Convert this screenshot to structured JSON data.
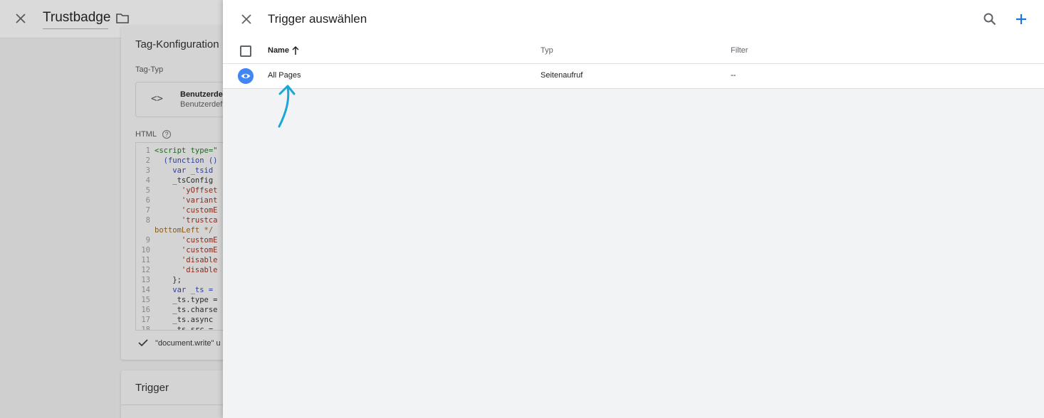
{
  "background_editor": {
    "title": "Trustbadge",
    "section_title": "Tag-Konfiguration",
    "tag_type_label": "Tag-Typ",
    "tag_type_name": "Benutzerde",
    "tag_type_sub": "Benutzerdef",
    "code_icon": "<>",
    "html_label": "HTML",
    "help_glyph": "?",
    "code_lines": [
      {
        "num": "1",
        "text": "<script type=\"",
        "style": "tag"
      },
      {
        "num": "2",
        "text": "  (function ()",
        "style": "kw"
      },
      {
        "num": "3",
        "text": "    var _tsid",
        "style": "kw"
      },
      {
        "num": "4",
        "text": "    _tsConfig",
        "style": "plain"
      },
      {
        "num": "5",
        "text": "      'yOffset",
        "style": "str"
      },
      {
        "num": "6",
        "text": "      'variant",
        "style": "str"
      },
      {
        "num": "7",
        "text": "      'customE",
        "style": "str"
      },
      {
        "num": "8",
        "text": "      'trustca",
        "style": "str"
      },
      {
        "num": "",
        "text": "bottomLeft */",
        "style": "cm"
      },
      {
        "num": "9",
        "text": "      'customE",
        "style": "str"
      },
      {
        "num": "10",
        "text": "      'customE",
        "style": "str"
      },
      {
        "num": "11",
        "text": "      'disable",
        "style": "str"
      },
      {
        "num": "12",
        "text": "      'disable",
        "style": "str"
      },
      {
        "num": "13",
        "text": "    };",
        "style": "plain"
      },
      {
        "num": "14",
        "text": "    var _ts =",
        "style": "kw"
      },
      {
        "num": "15",
        "text": "    _ts.type =",
        "style": "plain"
      },
      {
        "num": "16",
        "text": "    _ts.charse",
        "style": "plain"
      },
      {
        "num": "17",
        "text": "    _ts.async",
        "style": "plain"
      },
      {
        "num": "18",
        "text": "    _ts.src =",
        "style": "plain"
      }
    ],
    "document_write_text": "\"document.write\" u",
    "trigger_section_title": "Trigger"
  },
  "sheet": {
    "title": "Trigger auswählen",
    "columns": {
      "name": "Name",
      "typ": "Typ",
      "filter": "Filter"
    },
    "rows": [
      {
        "name": "All Pages",
        "typ": "Seitenaufruf",
        "filter": "--",
        "icon": "eye-icon"
      }
    ],
    "icons": {
      "close": "close-icon",
      "search": "search-icon",
      "add": "add-icon",
      "sort": "arrow-up-icon"
    }
  },
  "colors": {
    "accent_blue": "#1a73e8",
    "eye_badge": "#4285f4",
    "annotation_arrow": "#1aa7d8"
  }
}
